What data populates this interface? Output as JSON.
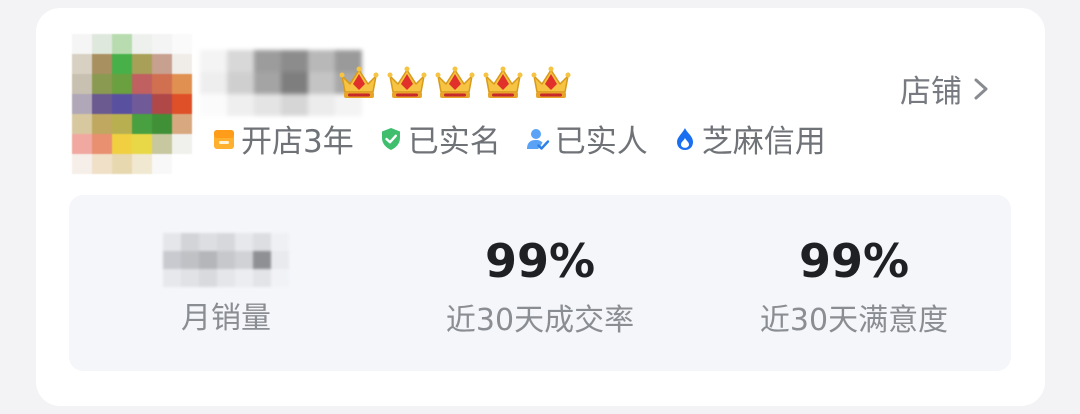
{
  "shop": {
    "store_link_label": "店铺",
    "crown_count": 5,
    "crown_icon": "crown-icon",
    "chevron_icon": "chevron-right-icon"
  },
  "badges": [
    {
      "icon": "shop-icon",
      "label": "开店3年",
      "color": "#ffb02e"
    },
    {
      "icon": "shield-check-icon",
      "label": "已实名",
      "color": "#3fbf6e"
    },
    {
      "icon": "person-verified-icon",
      "label": "已实人",
      "color": "#3e8ff0"
    },
    {
      "icon": "sesame-flame-icon",
      "label": "芝麻信用",
      "color": "#1a6ff0"
    }
  ],
  "stats": [
    {
      "value": "",
      "label": "月销量"
    },
    {
      "value": "99%",
      "label": "近30天成交率"
    },
    {
      "value": "99%",
      "label": "近30天满意度"
    }
  ],
  "colors": {
    "page_bg": "#f3f3f6",
    "card_bg": "#ffffff",
    "stats_bg": "#f5f6fa",
    "value_text": "#1f2023",
    "label_text": "#8a8d92"
  }
}
